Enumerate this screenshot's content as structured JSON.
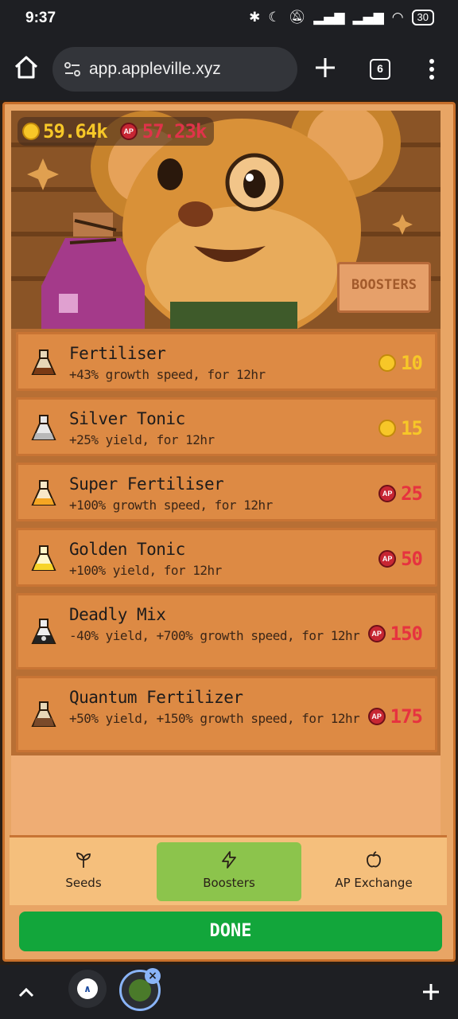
{
  "status_bar": {
    "time": "9:37",
    "battery": "30"
  },
  "browser": {
    "url": "app.appleville.xyz",
    "tab_count": "6"
  },
  "game": {
    "coins": "59.64k",
    "ap": "57.23k",
    "ap_symbol": "AP",
    "banner_sign": "BOOSTERS",
    "boosters": [
      {
        "name": "Fertiliser",
        "desc": "+43% growth speed, for 12hr",
        "currency": "coin",
        "price": "10",
        "icon": "brown-potion-icon",
        "color": "#8a4a1e"
      },
      {
        "name": "Silver Tonic",
        "desc": "+25% yield, for 12hr",
        "currency": "coin",
        "price": "15",
        "icon": "silver-potion-icon",
        "color": "#c8c8c8"
      },
      {
        "name": "Super Fertiliser",
        "desc": "+100% growth speed, for 12hr",
        "currency": "ap",
        "price": "25",
        "icon": "orange-potion-icon",
        "color": "#f5a623"
      },
      {
        "name": "Golden Tonic",
        "desc": "+100% yield, for 12hr",
        "currency": "ap",
        "price": "50",
        "icon": "golden-potion-icon",
        "color": "#f7d42a"
      },
      {
        "name": "Deadly Mix",
        "desc": "-40% yield, +700% growth speed, for 12hr",
        "currency": "ap",
        "price": "150",
        "icon": "skull-potion-icon",
        "color": "#222222"
      },
      {
        "name": "Quantum Fertilizer",
        "desc": "+50% yield, +150% growth speed, for 12hr",
        "currency": "ap",
        "price": "175",
        "icon": "quantum-potion-icon",
        "color": "#7a4a2a"
      }
    ],
    "nav": {
      "seeds": "Seeds",
      "boosters": "Boosters",
      "ap_exchange": "AP Exchange"
    },
    "done": "DONE"
  }
}
